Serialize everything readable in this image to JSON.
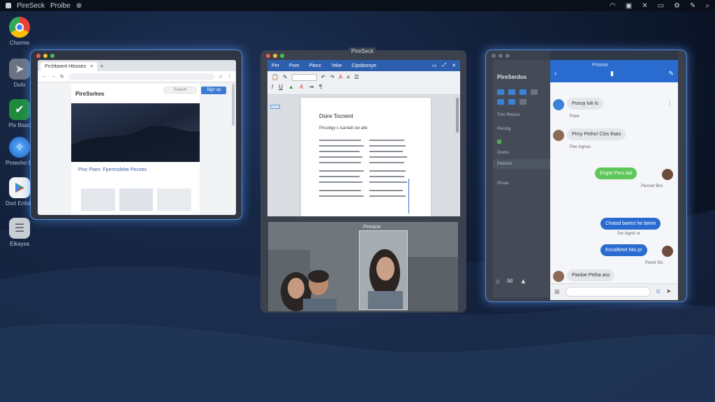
{
  "topbar": {
    "app_name": "PireSeck",
    "menu_item": "Proibe",
    "status_icons": [
      "wifi-icon",
      "screen-icon",
      "battery-icon",
      "settings-icon",
      "search-icon"
    ]
  },
  "dock": {
    "items": [
      {
        "label": "Chorme",
        "icon": "chrome-icon"
      },
      {
        "label": "Dulo",
        "icon": "app-icon"
      },
      {
        "label": "Pix Baso",
        "icon": "check-icon"
      },
      {
        "label": "Proeoho Ba",
        "icon": "safari-icon"
      },
      {
        "label": "Dort Enfuhe",
        "icon": "play-store-icon"
      },
      {
        "label": "Eikaysa",
        "icon": "files-icon"
      }
    ]
  },
  "browser": {
    "tab_label": "Prcfrboent Hlosses",
    "tab_close": "×",
    "new_tab": "+",
    "site_title": "PireSsrkes",
    "hero_heading": "Pinc Piam: Fpemndebe Pircoes",
    "cta_label": "Sign up",
    "search_placeholder": "Search"
  },
  "word": {
    "window_title": "PireSeck",
    "ribbon_tabs": [
      "Pirr",
      "Pore",
      "Pienc",
      "Yeke",
      "Cipsboroye"
    ],
    "document_title": "Dsire Tocnent",
    "doc_subtitle": "Pricobgy s isanlatt ow alte"
  },
  "video": {
    "pip_label": "Pireacie"
  },
  "messenger": {
    "app_title": "PireSerdos",
    "header_title": "Prisrea",
    "sidebar_items": [
      "Trirs Rreuss",
      "Perong",
      "Doves",
      "Pelshos",
      "Piruas"
    ],
    "messages": [
      {
        "text": "Posuy tok is",
        "sub": "Pxee",
        "side": "in"
      },
      {
        "text": "Pirsy Peiho! Clos thais",
        "sub": "Pee ingnas",
        "side": "in"
      },
      {
        "text": "Engre Pors aal",
        "sub": "Pwsnef Bnc",
        "side": "out-green"
      },
      {
        "text": "Chatsd barect he beine",
        "sub": "Sor ikgrot ra",
        "side": "out-blue"
      },
      {
        "text": "Encaftetet hits pr",
        "sub": "Piemt Sts",
        "side": "out-blue"
      },
      {
        "text": "Paoloe Peiha ass",
        "sub": "",
        "side": "in"
      }
    ],
    "reply_placeholder": ""
  },
  "colors": {
    "accent": "#4f8ee0",
    "ribbon": "#2d5fae",
    "messenger_header": "#2a6bd0",
    "bubble_green": "#5fc65a"
  }
}
